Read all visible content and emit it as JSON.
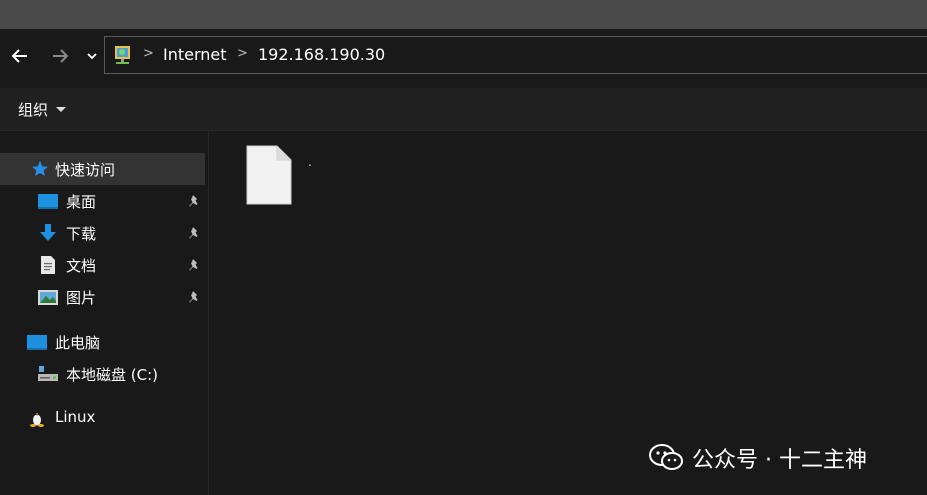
{
  "address": {
    "segments": [
      "Internet",
      "192.168.190.30"
    ]
  },
  "toolbar": {
    "organize_label": "组织"
  },
  "sidebar": {
    "quick_access": "快速访问",
    "items": [
      {
        "label": "桌面",
        "icon": "desktop-icon",
        "pinned": true
      },
      {
        "label": "下载",
        "icon": "download-icon",
        "pinned": true
      },
      {
        "label": "文档",
        "icon": "document-icon",
        "pinned": true
      },
      {
        "label": "图片",
        "icon": "pictures-icon",
        "pinned": true
      }
    ],
    "this_pc": "此电脑",
    "local_disk": "本地磁盘 (C:)",
    "linux": "Linux"
  },
  "content": {
    "files": [
      {
        "name": ".",
        "icon": "blank-file-icon"
      }
    ]
  },
  "watermark": {
    "text": "公众号 · 十二主神"
  },
  "colors": {
    "background": "#191919",
    "titlebar": "#4a4a4a",
    "selected": "#333333",
    "accent_blue": "#1e90e0"
  }
}
